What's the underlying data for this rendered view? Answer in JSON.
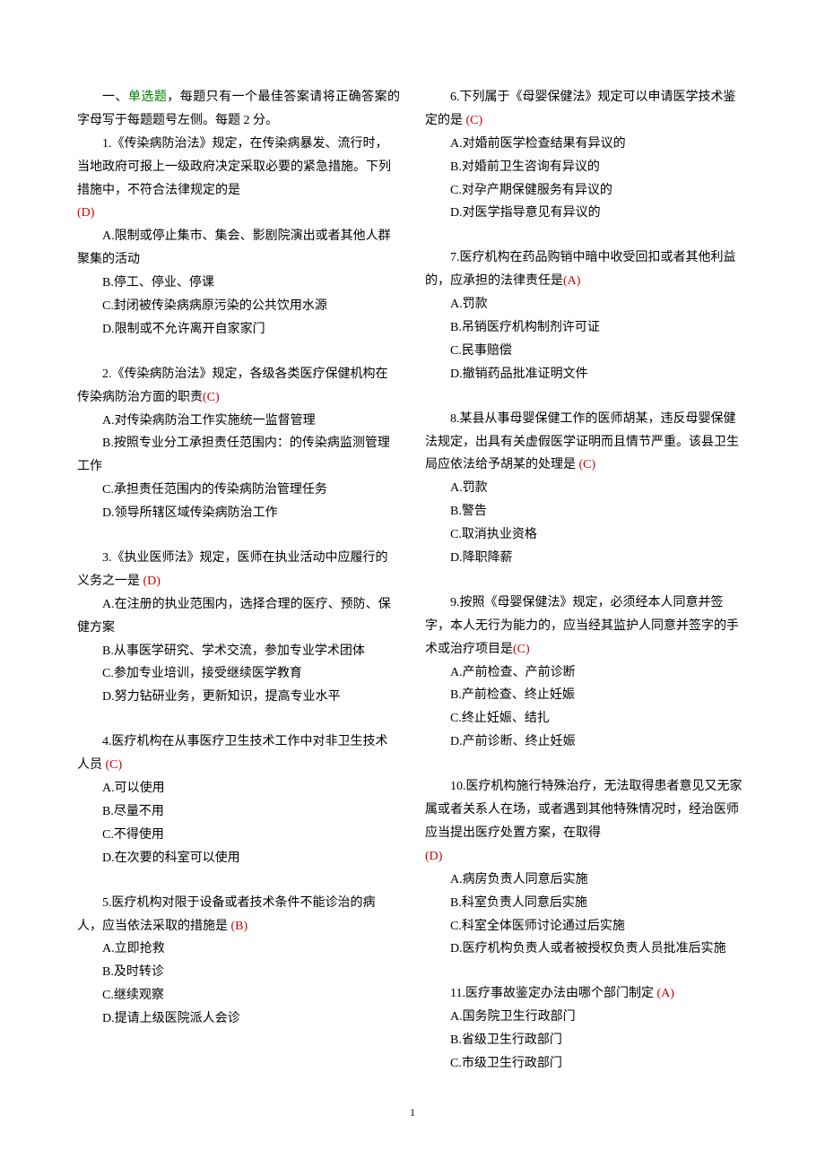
{
  "intro_pre": "一、",
  "intro_green": "单选题",
  "intro_post": "，每题只有一个最佳答案请将正确答案的字母写于每题题号左侧。每题 2 分。",
  "questions": [
    {
      "num": "1.",
      "stem": "《传染病防治法》规定，在传染病暴发、流行时，当地政府可报上一级政府决定采取必要的紧急措施。下列措施中，不符合法律规定的是",
      "ans": "(D)",
      "inline": false,
      "opts": [
        "A.限制或停止集市、集会、影剧院演出或者其他人群聚集的活动",
        "B.停工、停业、停课",
        "C.封闭被传染病病原污染的公共饮用水源",
        "D.限制或不允许离开自家家门"
      ]
    },
    {
      "num": "2.",
      "stem": "《传染病防治法》规定，各级各类医疗保健机构在传染病防治方面的职责",
      "ans": "(C)",
      "inline": true,
      "opts": [
        "A.对传染病防治工作实施统一监督管理",
        "B.按照专业分工承担责任范围内：的传染病监测管理工作",
        "C.承担责任范围内的传染病防治管理任务",
        "D.领导所辖区域传染病防治工作"
      ]
    },
    {
      "num": "3.",
      "stem": "《执业医师法》规定，医师在执业活动中应履行的义务之一是",
      "ans": "  (D)",
      "inline": true,
      "opts": [
        "A.在注册的执业范围内，选择合理的医疗、预防、保健方案",
        "B.从事医学研究、学术交流，参加专业学术团体",
        "C.参加专业培训，接受继续医学教育",
        "D.努力钻研业务，更新知识，提高专业水平"
      ]
    },
    {
      "num": "  4.",
      "stem": "医疗机构在从事医疗卫生技术工作中对非卫生技术人员",
      "ans": "  (C)",
      "inline": true,
      "opts": [
        "A.可以使用",
        "B.尽量不用",
        "C.不得使用",
        "D.在次要的科室可以使用"
      ]
    },
    {
      "num": "5.",
      "stem": "医疗机构对限于设备或者技术条件不能诊治的病人，应当依法采取的措施是",
      "ans": "    (B)",
      "inline": true,
      "opts": [
        "A.立即抢救",
        "B.及时转诊",
        "C.继续观察",
        "D.提请上级医院派人会诊"
      ]
    },
    {
      "num": "6.",
      "stem": "下列属于《母婴保健法》规定可以申请医学技术鉴定的是",
      "ans": "  (C)",
      "inline": true,
      "opts": [
        "A.对婚前医学检查结果有异议的",
        "B.对婚前卫生咨询有异议的",
        "C.对孕产期保健服务有异议的",
        "D.对医学指导意见有异议的"
      ]
    },
    {
      "num": "7.",
      "stem": "医疗机构在药品购销中暗中收受回扣或者其他利益的，应承担的法律责任是",
      "ans": "(A)",
      "inline": true,
      "opts": [
        "A.罚款",
        "B.吊销医疗机构制剂许可证",
        "C.民事赔偿",
        "D.撤销药品批准证明文件"
      ]
    },
    {
      "num": "8.",
      "stem": "某县从事母婴保健工作的医师胡某，违反母婴保健法规定，出具有关虚假医学证明而且情节严重。该县卫生局应依法给予胡某的处理是",
      "ans": "    (C)",
      "inline": true,
      "opts": [
        "A.罚款",
        "B.警告",
        "C.取消执业资格",
        "D.降职降薪"
      ]
    },
    {
      "num": "9.",
      "stem": "按照《母婴保健法》规定，必须经本人同意并签字，本人无行为能力的，应当经其监护人同意并签字的手术或治疗项目是",
      "ans": "(C)",
      "inline": true,
      "opts": [
        "A.产前检查、产前诊断",
        "B.产前检查、终止妊娠",
        "C.终止妊娠、结扎",
        "D.产前诊断、终止妊娠"
      ]
    },
    {
      "num": "10.",
      "stem": "医疗机构施行特殊治疗，无法取得患者意见又无家属或者关系人在场，或者遇到其他特殊情况时，经治医师应当提出医疗处置方案，在取得",
      "ans": "(D)",
      "inline": false,
      "opts": [
        "A.病房负责人同意后实施",
        "B.科室负责人同意后实施",
        "C.科室全体医师讨论通过后实施",
        "D.医疗机构负责人或者被授权负责人员批准后实施"
      ]
    },
    {
      "num": "11.",
      "stem": "医疗事故鉴定办法由哪个部门制定",
      "ans": "    (A)",
      "inline": true,
      "opts": [
        "A.国务院卫生行政部门",
        "B.省级卫生行政部门",
        "C.市级卫生行政部门"
      ]
    }
  ],
  "page_number": "1"
}
